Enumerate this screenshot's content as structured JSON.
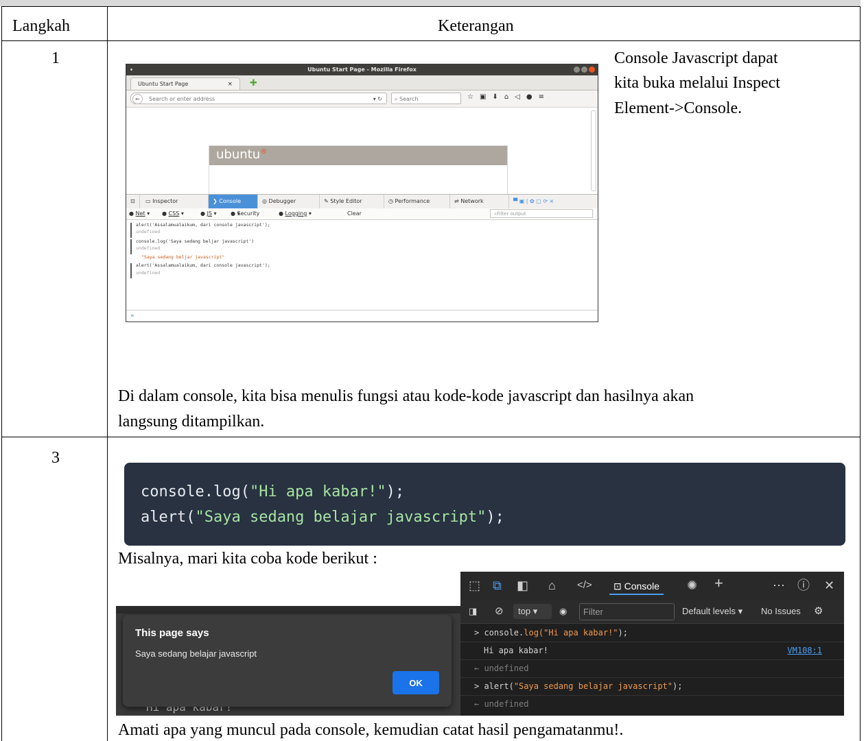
{
  "table": {
    "header": {
      "col1": "Langkah",
      "col2": "Keterangan"
    },
    "rows": [
      {
        "step": "1",
        "side_text": [
          "Console Javascript dapat",
          "kita buka melalui Inspect",
          "Element->Console."
        ],
        "note": [
          "Di dalam console, kita bisa menulis fungsi atau kode-kode javascript dan hasilnya akan",
          "langsung ditampilkan."
        ]
      },
      {
        "step": "3",
        "intro": "Misalnya, mari kita coba kode berikut :",
        "note": "Amati apa yang muncul pada console, kemudian catat hasil pengamatanmu!."
      }
    ]
  },
  "firefox": {
    "window_title": "Ubuntu Start Page - Mozilla Firefox",
    "tab_title": "Ubuntu Start Page",
    "address_placeholder": "Search or enter address",
    "search_placeholder": "Search",
    "page_logo": "ubuntu",
    "devtools_tabs": [
      "Inspector",
      "Console",
      "Debugger",
      "Style Editor",
      "Performance",
      "Network"
    ],
    "active_tab": "Console",
    "filters": [
      "Net",
      "CSS",
      "JS",
      "Security",
      "Logging",
      "Clear"
    ],
    "filter_output_placeholder": "Filter output",
    "log": [
      "alert('Assalamualaikum, dari console javascript');",
      "undefined",
      "console.log('Saya sedang beljar javascript')",
      "undefined",
      "\"Saya sedang beljar javascript\"",
      "alert('Assalamualaikum, dari console javascript');",
      "undefined"
    ],
    "prompt": "»"
  },
  "code": {
    "line1": {
      "pre": "console.log(",
      "str": "\"Hi apa kabar!\"",
      "post": ");"
    },
    "line2": {
      "pre": "alert(",
      "str": "\"Saya sedang belajar javascript\"",
      "post": ");"
    }
  },
  "alert_dialog": {
    "title": "This page says",
    "message": "Saya sedang belajar javascript",
    "ok": "OK",
    "background_text": "Hi apa kabar!"
  },
  "devtools": {
    "tab": "Console",
    "context": "top",
    "filter_placeholder": "Filter",
    "levels": "Default levels ▾",
    "issues": "No Issues",
    "log": [
      {
        "prefix": "> ",
        "fn": "console.",
        "call": "log(",
        "str": "\"Hi apa kabar!\"",
        "end": ");"
      },
      {
        "output": "Hi apa kabar!",
        "source": "VM108:1"
      },
      {
        "prefix": "← ",
        "undef": "undefined"
      },
      {
        "prefix": "> ",
        "call": "alert(",
        "str": "\"Saya sedang belajar javascript\"",
        "end": ");"
      },
      {
        "prefix": "← ",
        "undef": "undefined"
      }
    ]
  },
  "colors": {
    "code_bg": "#283241",
    "edge_link": "#4a9df0",
    "ubuntu_orange": "#e95420"
  }
}
